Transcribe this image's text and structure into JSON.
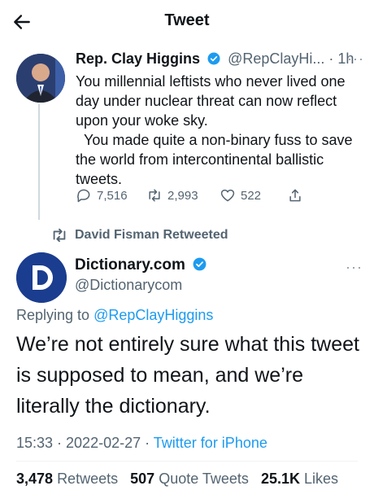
{
  "header": {
    "title": "Tweet"
  },
  "quoted_tweet": {
    "name": "Rep. Clay Higgins",
    "handle": "@RepClayHi...",
    "time": "· 1h",
    "text": "You millennial leftists who never lived one day under nuclear threat can now reflect upon your woke sky.\n  You made quite a non-binary fuss to save the world from intercontinental ballistic tweets.",
    "replies": "7,516",
    "retweets": "2,993",
    "likes": "522"
  },
  "retweet_banner": {
    "text": "David Fisman Retweeted"
  },
  "main_tweet": {
    "name": "Dictionary.com",
    "handle": "@Dictionarycom",
    "replying_prefix": "Replying to",
    "replying_to": "@RepClayHiggins",
    "text": "We’re not entirely sure what this tweet is supposed to mean, and we’re literally the dictionary.",
    "time": "15:33 · 2022-02-27 ·",
    "source": "Twitter for iPhone",
    "retweets_count": "3,478",
    "retweets_label": "Retweets",
    "quotes_count": "507",
    "quotes_label": "Quote Tweets",
    "likes_count": "25.1K",
    "likes_label": "Likes"
  },
  "colors": {
    "accent": "#1d9bf0",
    "muted": "#536471",
    "text": "#0f1419"
  },
  "icons": [
    "back-arrow-icon",
    "verified-badge-icon",
    "reply-icon",
    "retweet-icon",
    "like-icon",
    "share-icon",
    "more-icon"
  ]
}
